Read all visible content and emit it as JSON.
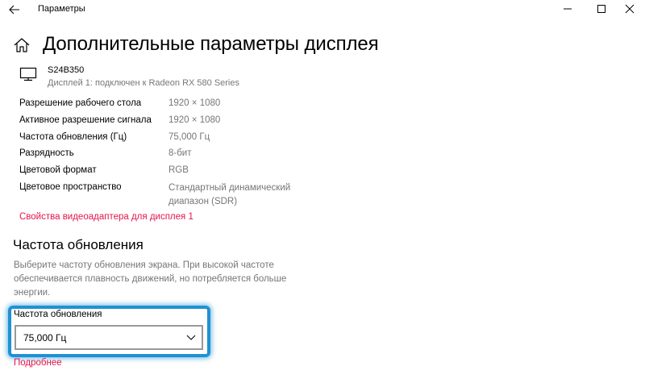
{
  "window": {
    "title": "Параметры",
    "back_icon": "arrow-left-icon",
    "minimize_icon": "minimize-icon",
    "maximize_icon": "maximize-icon",
    "close_icon": "close-icon"
  },
  "header": {
    "home_icon": "home-icon",
    "title": "Дополнительные параметры дисплея"
  },
  "display": {
    "icon": "monitor-icon",
    "name": "S24B350",
    "subtitle": "Дисплей 1: подключен к Radeon RX 580 Series"
  },
  "info": [
    {
      "label": "Разрешение рабочего стола",
      "value": "1920 × 1080"
    },
    {
      "label": "Активное разрешение сигнала",
      "value": "1920 × 1080"
    },
    {
      "label": "Частота обновления (Гц)",
      "value": "75,000 Гц"
    },
    {
      "label": "Разрядность",
      "value": "8-бит"
    },
    {
      "label": "Цветовой формат",
      "value": "RGB"
    },
    {
      "label": "Цветовое пространство",
      "value": "Стандартный динамический диапазон (SDR)"
    }
  ],
  "adapter_link": "Свойства видеоадаптера для дисплея 1",
  "refresh_section": {
    "title": "Частота обновления",
    "description": "Выберите частоту обновления экрана. При высокой частоте обеспечивается плавность движений, но потребляется больше энергии.",
    "dropdown_label": "Частота обновления",
    "dropdown_value": "75,000 Гц",
    "dropdown_icon": "chevron-down-icon",
    "more_link": "Подробнее"
  },
  "colors": {
    "accent_link": "#e3154a",
    "highlight": "#1f91d4",
    "secondary_text": "#767676"
  }
}
